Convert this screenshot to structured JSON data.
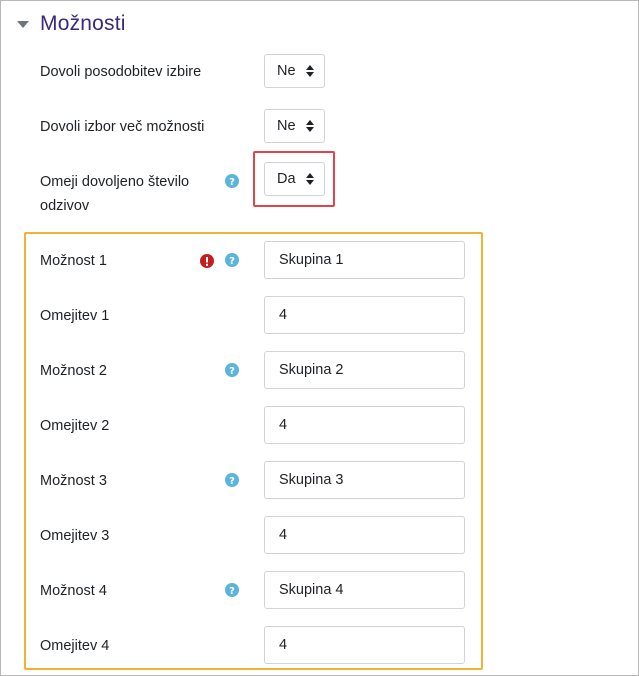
{
  "section": {
    "title": "Možnosti",
    "collapse_icon": "triangle-down-icon"
  },
  "settings": [
    {
      "label": "Dovoli posodobitev izbire",
      "value": "Ne"
    },
    {
      "label": "Dovoli izbor več možnosti",
      "value": "Ne"
    },
    {
      "label": "Omeji dovoljeno število odzivov",
      "label_line1": "Omeji dovoljeno število",
      "label_line2": "odzivov",
      "value": "Da",
      "help_icon": "question-circle-icon"
    }
  ],
  "options": [
    {
      "label": "Možnost 1",
      "value": "Skupina 1",
      "required_icon": "exclamation-circle-icon",
      "help_icon": "question-circle-icon"
    },
    {
      "label": "Omejitev 1",
      "value": "4"
    },
    {
      "label": "Možnost 2",
      "value": "Skupina 2",
      "help_icon": "question-circle-icon"
    },
    {
      "label": "Omejitev 2",
      "value": "4"
    },
    {
      "label": "Možnost 3",
      "value": "Skupina 3",
      "help_icon": "question-circle-icon"
    },
    {
      "label": "Omejitev 3",
      "value": "4"
    },
    {
      "label": "Možnost 4",
      "value": "Skupina 4",
      "help_icon": "question-circle-icon"
    },
    {
      "label": "Omejitev 4",
      "value": "4"
    }
  ],
  "colors": {
    "title": "#3b2a78",
    "help_icon": "#5bb4db",
    "error_icon": "#c41e1e",
    "highlight_red": "#e0454a",
    "highlight_orange": "#f2b233"
  }
}
